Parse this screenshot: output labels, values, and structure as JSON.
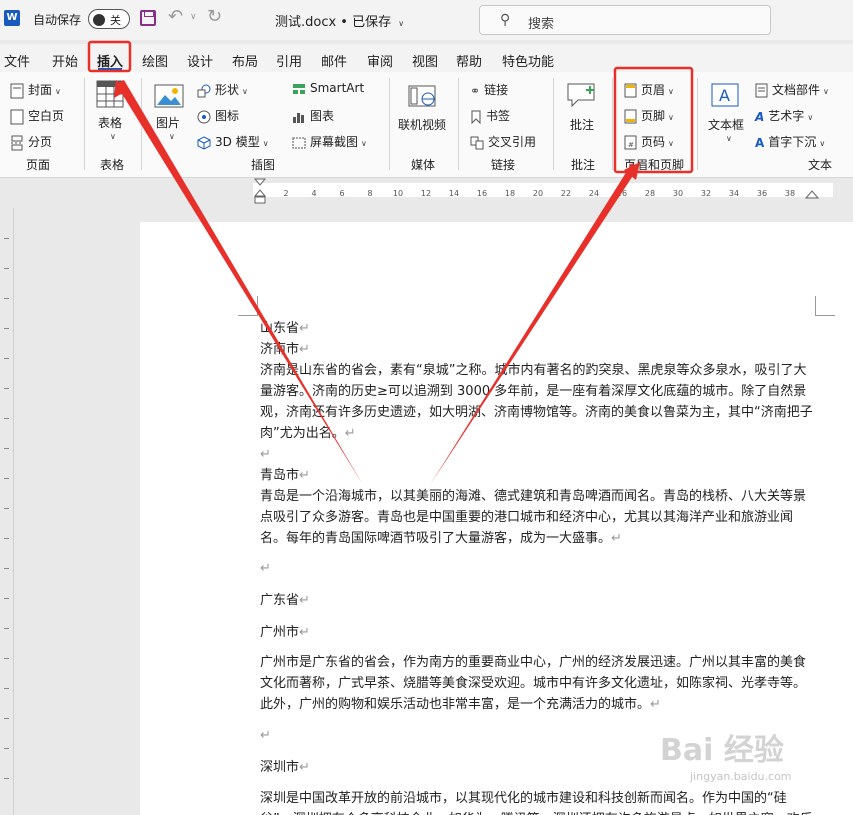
{
  "titlebar": {
    "autosave_label": "自动保存",
    "toggle_state": "关",
    "doc_title": "测试.docx • 已保存",
    "search_placeholder": "搜索"
  },
  "tabs": [
    "文件",
    "开始",
    "插入",
    "绘图",
    "设计",
    "布局",
    "引用",
    "邮件",
    "审阅",
    "视图",
    "帮助",
    "特色功能"
  ],
  "active_tab": "插入",
  "ribbon": {
    "pages": {
      "cover": "封面",
      "blank": "空白页",
      "break": "分页",
      "group": "页面"
    },
    "table": {
      "table": "表格",
      "group": "表格"
    },
    "illustrations": {
      "picture": "图片",
      "shapes": "形状",
      "icons": "图标",
      "model3d": "3D 模型",
      "smartart": "SmartArt",
      "chart": "图表",
      "screenshot": "屏幕截图",
      "group": "插图"
    },
    "media": {
      "video": "联机视频",
      "group": "媒体"
    },
    "links": {
      "link": "链接",
      "bookmark": "书签",
      "crossref": "交叉引用",
      "group": "链接"
    },
    "comments": {
      "comment": "批注",
      "group": "批注"
    },
    "header_footer": {
      "header": "页眉",
      "footer": "页脚",
      "page_number": "页码",
      "group": "页眉和页脚"
    },
    "text": {
      "textbox": "文本框",
      "docparts": "文档部件",
      "wordart": "艺术字",
      "dropcap": "首字下沉",
      "group": "文本"
    }
  },
  "ruler_ticks": [
    "2",
    "4",
    "6",
    "8",
    "10",
    "12",
    "14",
    "16",
    "18",
    "20",
    "22",
    "24",
    "26",
    "28",
    "30",
    "32",
    "34",
    "36",
    "38"
  ],
  "document": {
    "p1": "山东省",
    "p2": "济南市",
    "p3": "济南是山东省的省会，素有“泉城”之称。城市内有著名的趵突泉、黑虎泉等众多泉水，吸引了大量游客。济南的历史≥可以追溯到 3000 多年前，是一座有着深厚文化底蕴的城市。除了自然景观，济南还有许多历史遗迹，如大明湖、济南博物馆等。济南的美食以鲁菜为主，其中“济南把子肉”尤为出名。",
    "p4": "",
    "p5": "青岛市",
    "p6": "青岛是一个沿海城市，以其美丽的海滩、德式建筑和青岛啤酒而闻名。青岛的栈桥、八大关等景点吸引了众多游客。青岛也是中国重要的港口城市和经济中心，尤其以其海洋产业和旅游业闻名。每年的青岛国际啤酒节吸引了大量游客，成为一大盛事。",
    "p7": "",
    "p8": "广东省",
    "p9": "广州市",
    "p10": "广州市是广东省的省会，作为南方的重要商业中心，广州的经济发展迅速。广州以其丰富的美食文化而著称，广式早茶、烧腊等美食深受欢迎。城市中有许多文化遗址，如陈家祠、光孝寺等。此外，广州的购物和娱乐活动也非常丰富，是一个充满活力的城市。",
    "p11": "",
    "p12": "深圳市",
    "p13": "深圳是中国改革开放的前沿城市，以其现代化的城市建设和科技创新而闻名。作为中国的“硅谷”，深圳拥有众多高科技企业，如华为、腾讯等。深圳还拥有许多旅游景点，如世界之窗、欢乐谷等。",
    "para_mark": "↵"
  },
  "annotation_color": "#e8302a",
  "watermark": "Bai 经验",
  "watermark_sub": "jingyan.baidu.com"
}
